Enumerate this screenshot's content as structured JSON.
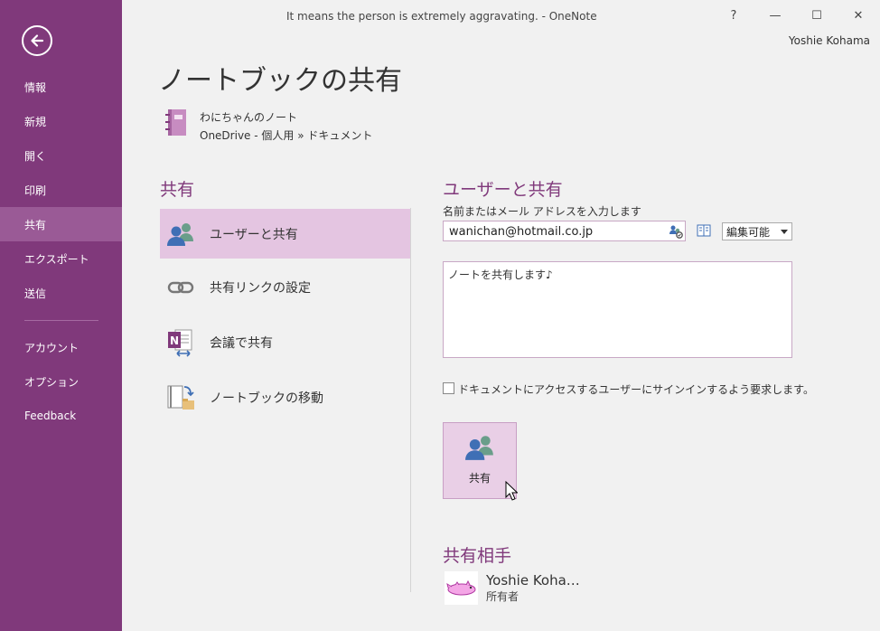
{
  "window": {
    "title": "It means the person is extremely aggravating. - OneNote",
    "help": "?",
    "minimize": "—",
    "maximize": "☐",
    "close": "✕",
    "user": "Yoshie Kohama"
  },
  "sidebar": {
    "items": [
      {
        "label": "情報"
      },
      {
        "label": "新規"
      },
      {
        "label": "開く"
      },
      {
        "label": "印刷"
      },
      {
        "label": "共有"
      },
      {
        "label": "エクスポート"
      },
      {
        "label": "送信"
      },
      {
        "label": "アカウント"
      },
      {
        "label": "オプション"
      },
      {
        "label": "Feedback"
      }
    ],
    "active": "共有",
    "accent": "#80397b"
  },
  "page": {
    "title": "ノートブックの共有",
    "notebook_name": "わにちゃんのノート",
    "notebook_path": "OneDrive - 個人用 » ドキュメント"
  },
  "share_section": {
    "heading": "共有",
    "options": [
      {
        "label": "ユーザーと共有",
        "icon": "people-icon"
      },
      {
        "label": "共有リンクの設定",
        "icon": "link-icon"
      },
      {
        "label": "会議で共有",
        "icon": "onenote-meeting-icon"
      },
      {
        "label": "ノートブックの移動",
        "icon": "move-notebook-icon"
      }
    ]
  },
  "share_with_users": {
    "heading": "ユーザーと共有",
    "field_label": "名前またはメール アドレスを入力します",
    "email_value": "wanichan@hotmail.co.jp",
    "permission": "編集可能",
    "message": "ノートを共有します♪",
    "require_signin_label": "ドキュメントにアクセスするユーザーにサインインするよう要求します。",
    "require_signin_checked": false,
    "share_button": "共有"
  },
  "shared_with": {
    "heading": "共有相手",
    "people": [
      {
        "name": "Yoshie Koha…",
        "role": "所有者"
      }
    ]
  }
}
